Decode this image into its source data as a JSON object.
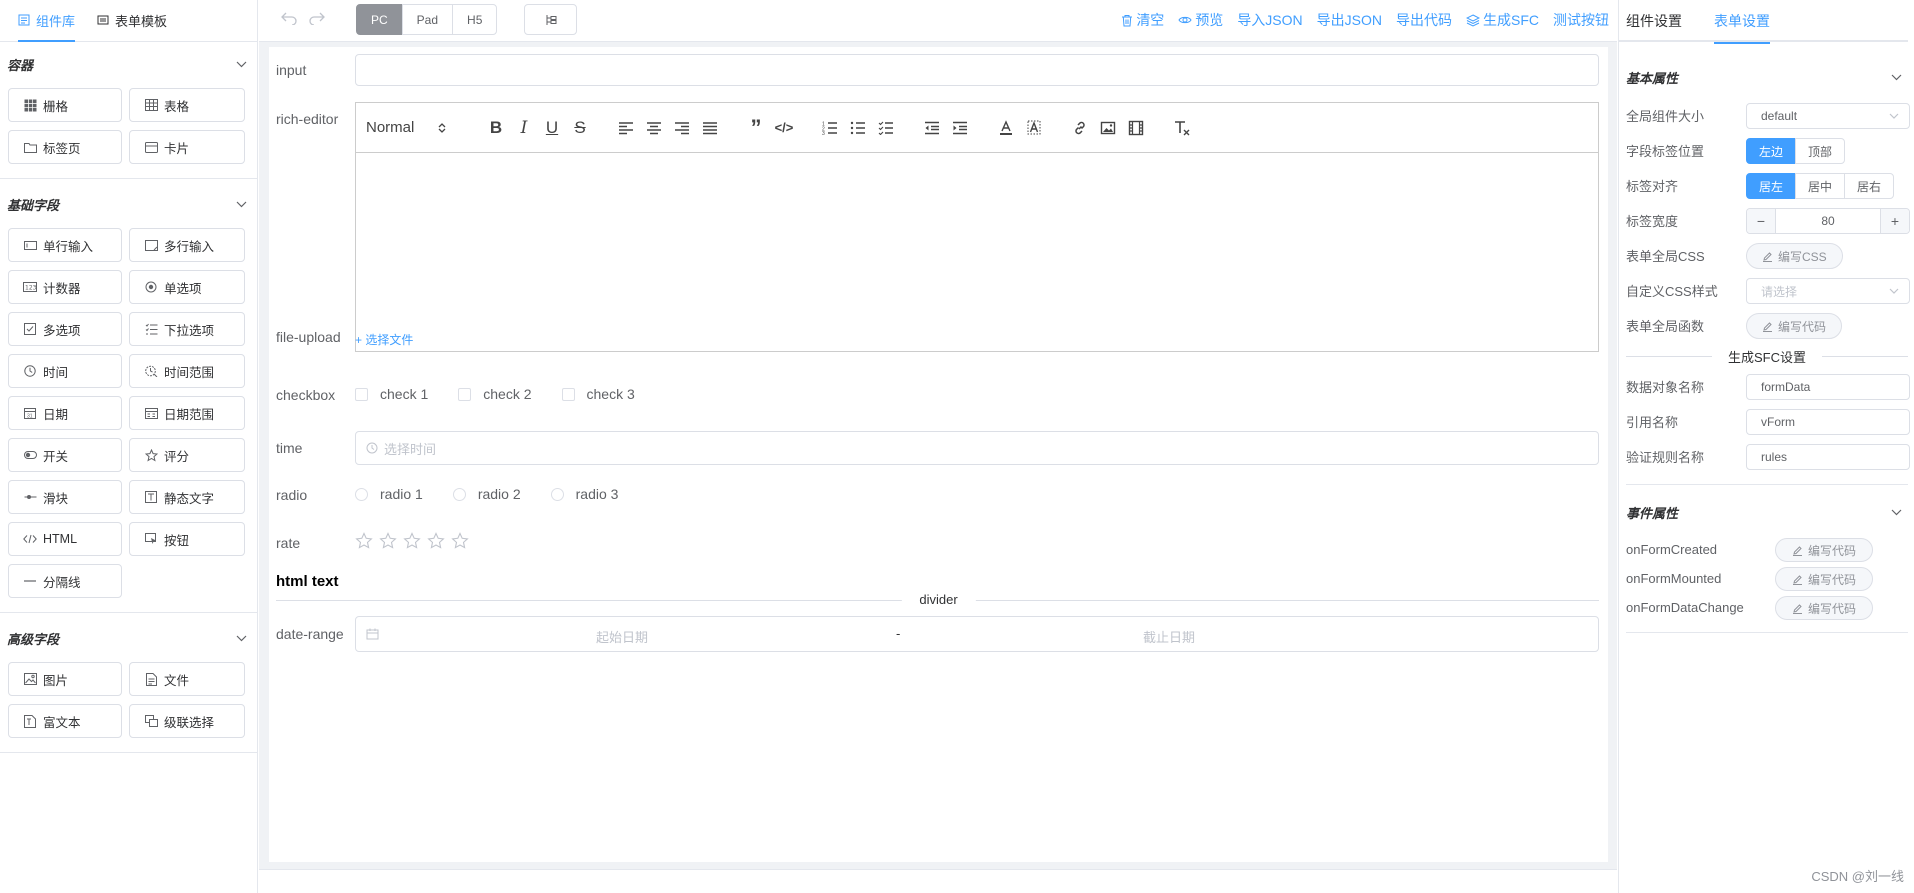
{
  "left_panel": {
    "tabs": [
      {
        "label": "组件库",
        "icon": "component-library-icon",
        "active": true
      },
      {
        "label": "表单模板",
        "icon": "form-template-icon",
        "active": false
      }
    ],
    "sections": [
      {
        "title": "容器",
        "items": [
          {
            "label": "栅格",
            "icon": "grid-icon"
          },
          {
            "label": "表格",
            "icon": "table-icon"
          },
          {
            "label": "标签页",
            "icon": "tabs-icon"
          },
          {
            "label": "卡片",
            "icon": "card-icon"
          }
        ]
      },
      {
        "title": "基础字段",
        "items": [
          {
            "label": "单行输入",
            "icon": "input-icon"
          },
          {
            "label": "多行输入",
            "icon": "textarea-icon"
          },
          {
            "label": "计数器",
            "icon": "number-icon"
          },
          {
            "label": "单选项",
            "icon": "radio-icon"
          },
          {
            "label": "多选项",
            "icon": "checkbox-icon"
          },
          {
            "label": "下拉选项",
            "icon": "select-icon"
          },
          {
            "label": "时间",
            "icon": "time-icon"
          },
          {
            "label": "时间范围",
            "icon": "time-range-icon"
          },
          {
            "label": "日期",
            "icon": "date-icon"
          },
          {
            "label": "日期范围",
            "icon": "date-range-icon"
          },
          {
            "label": "开关",
            "icon": "switch-icon"
          },
          {
            "label": "评分",
            "icon": "rate-icon"
          },
          {
            "label": "滑块",
            "icon": "slider-icon"
          },
          {
            "label": "静态文字",
            "icon": "static-text-icon"
          },
          {
            "label": "HTML",
            "icon": "html-icon"
          },
          {
            "label": "按钮",
            "icon": "button-icon"
          },
          {
            "label": "分隔线",
            "icon": "divider-icon"
          }
        ]
      },
      {
        "title": "高级字段",
        "items": [
          {
            "label": "图片",
            "icon": "picture-icon"
          },
          {
            "label": "文件",
            "icon": "file-icon"
          },
          {
            "label": "富文本",
            "icon": "rich-text-icon"
          },
          {
            "label": "级联选择",
            "icon": "cascader-icon"
          }
        ]
      }
    ]
  },
  "toolbar": {
    "device_buttons": [
      {
        "label": "PC",
        "active": true
      },
      {
        "label": "Pad",
        "active": false
      },
      {
        "label": "H5",
        "active": false
      }
    ],
    "actions": [
      {
        "label": "清空",
        "icon": "trash-icon"
      },
      {
        "label": "预览",
        "icon": "eye-icon"
      },
      {
        "label": "导入JSON",
        "icon": ""
      },
      {
        "label": "导出JSON",
        "icon": ""
      },
      {
        "label": "导出代码",
        "icon": ""
      },
      {
        "label": "生成SFC",
        "icon": "layers-icon"
      },
      {
        "label": "测试按钮",
        "icon": ""
      }
    ]
  },
  "canvas": {
    "input_label": "input",
    "rich_editor_label": "rich-editor",
    "rich_editor_header": "Normal",
    "file_upload_label": "file-upload",
    "file_upload_button": "+ 选择文件",
    "checkbox_label": "checkbox",
    "checkbox_options": [
      "check 1",
      "check 2",
      "check 3"
    ],
    "time_label": "time",
    "time_placeholder": "选择时间",
    "radio_label": "radio",
    "radio_options": [
      "radio 1",
      "radio 2",
      "radio 3"
    ],
    "rate_label": "rate",
    "rate_value": 0,
    "rate_max": 5,
    "html_text": "html text",
    "divider_text": "divider",
    "date_range_label": "date-range",
    "date_range_start_placeholder": "起始日期",
    "date_range_separator": "-",
    "date_range_end_placeholder": "截止日期"
  },
  "right_panel": {
    "tabs": [
      {
        "label": "组件设置",
        "active": false
      },
      {
        "label": "表单设置",
        "active": true
      }
    ],
    "basic_section_title": "基本属性",
    "global_size_label": "全局组件大小",
    "global_size_value": "default",
    "label_position_label": "字段标签位置",
    "label_position_options": [
      {
        "label": "左边",
        "active": true
      },
      {
        "label": "顶部",
        "active": false
      }
    ],
    "label_align_label": "标签对齐",
    "label_align_options": [
      {
        "label": "居左",
        "active": true
      },
      {
        "label": "居中",
        "active": false
      },
      {
        "label": "居右",
        "active": false
      }
    ],
    "label_width_label": "标签宽度",
    "label_width_value": "80",
    "global_css_label": "表单全局CSS",
    "global_css_button": "编写CSS",
    "custom_css_label": "自定义CSS样式",
    "custom_css_placeholder": "请选择",
    "global_func_label": "表单全局函数",
    "global_func_button": "编写代码",
    "sfc_divider": "生成SFC设置",
    "data_obj_label": "数据对象名称",
    "data_obj_value": "formData",
    "ref_name_label": "引用名称",
    "ref_name_value": "vForm",
    "rules_name_label": "验证规则名称",
    "rules_name_value": "rules",
    "event_section_title": "事件属性",
    "events": [
      {
        "name": "onFormCreated",
        "button": "编写代码"
      },
      {
        "name": "onFormMounted",
        "button": "编写代码"
      },
      {
        "name": "onFormDataChange",
        "button": "编写代码"
      }
    ]
  },
  "watermark": "CSDN @刘一线",
  "colors": {
    "accent": "#409eff",
    "device_active": "#909399",
    "canvas_bg": "#f0f2f5"
  }
}
